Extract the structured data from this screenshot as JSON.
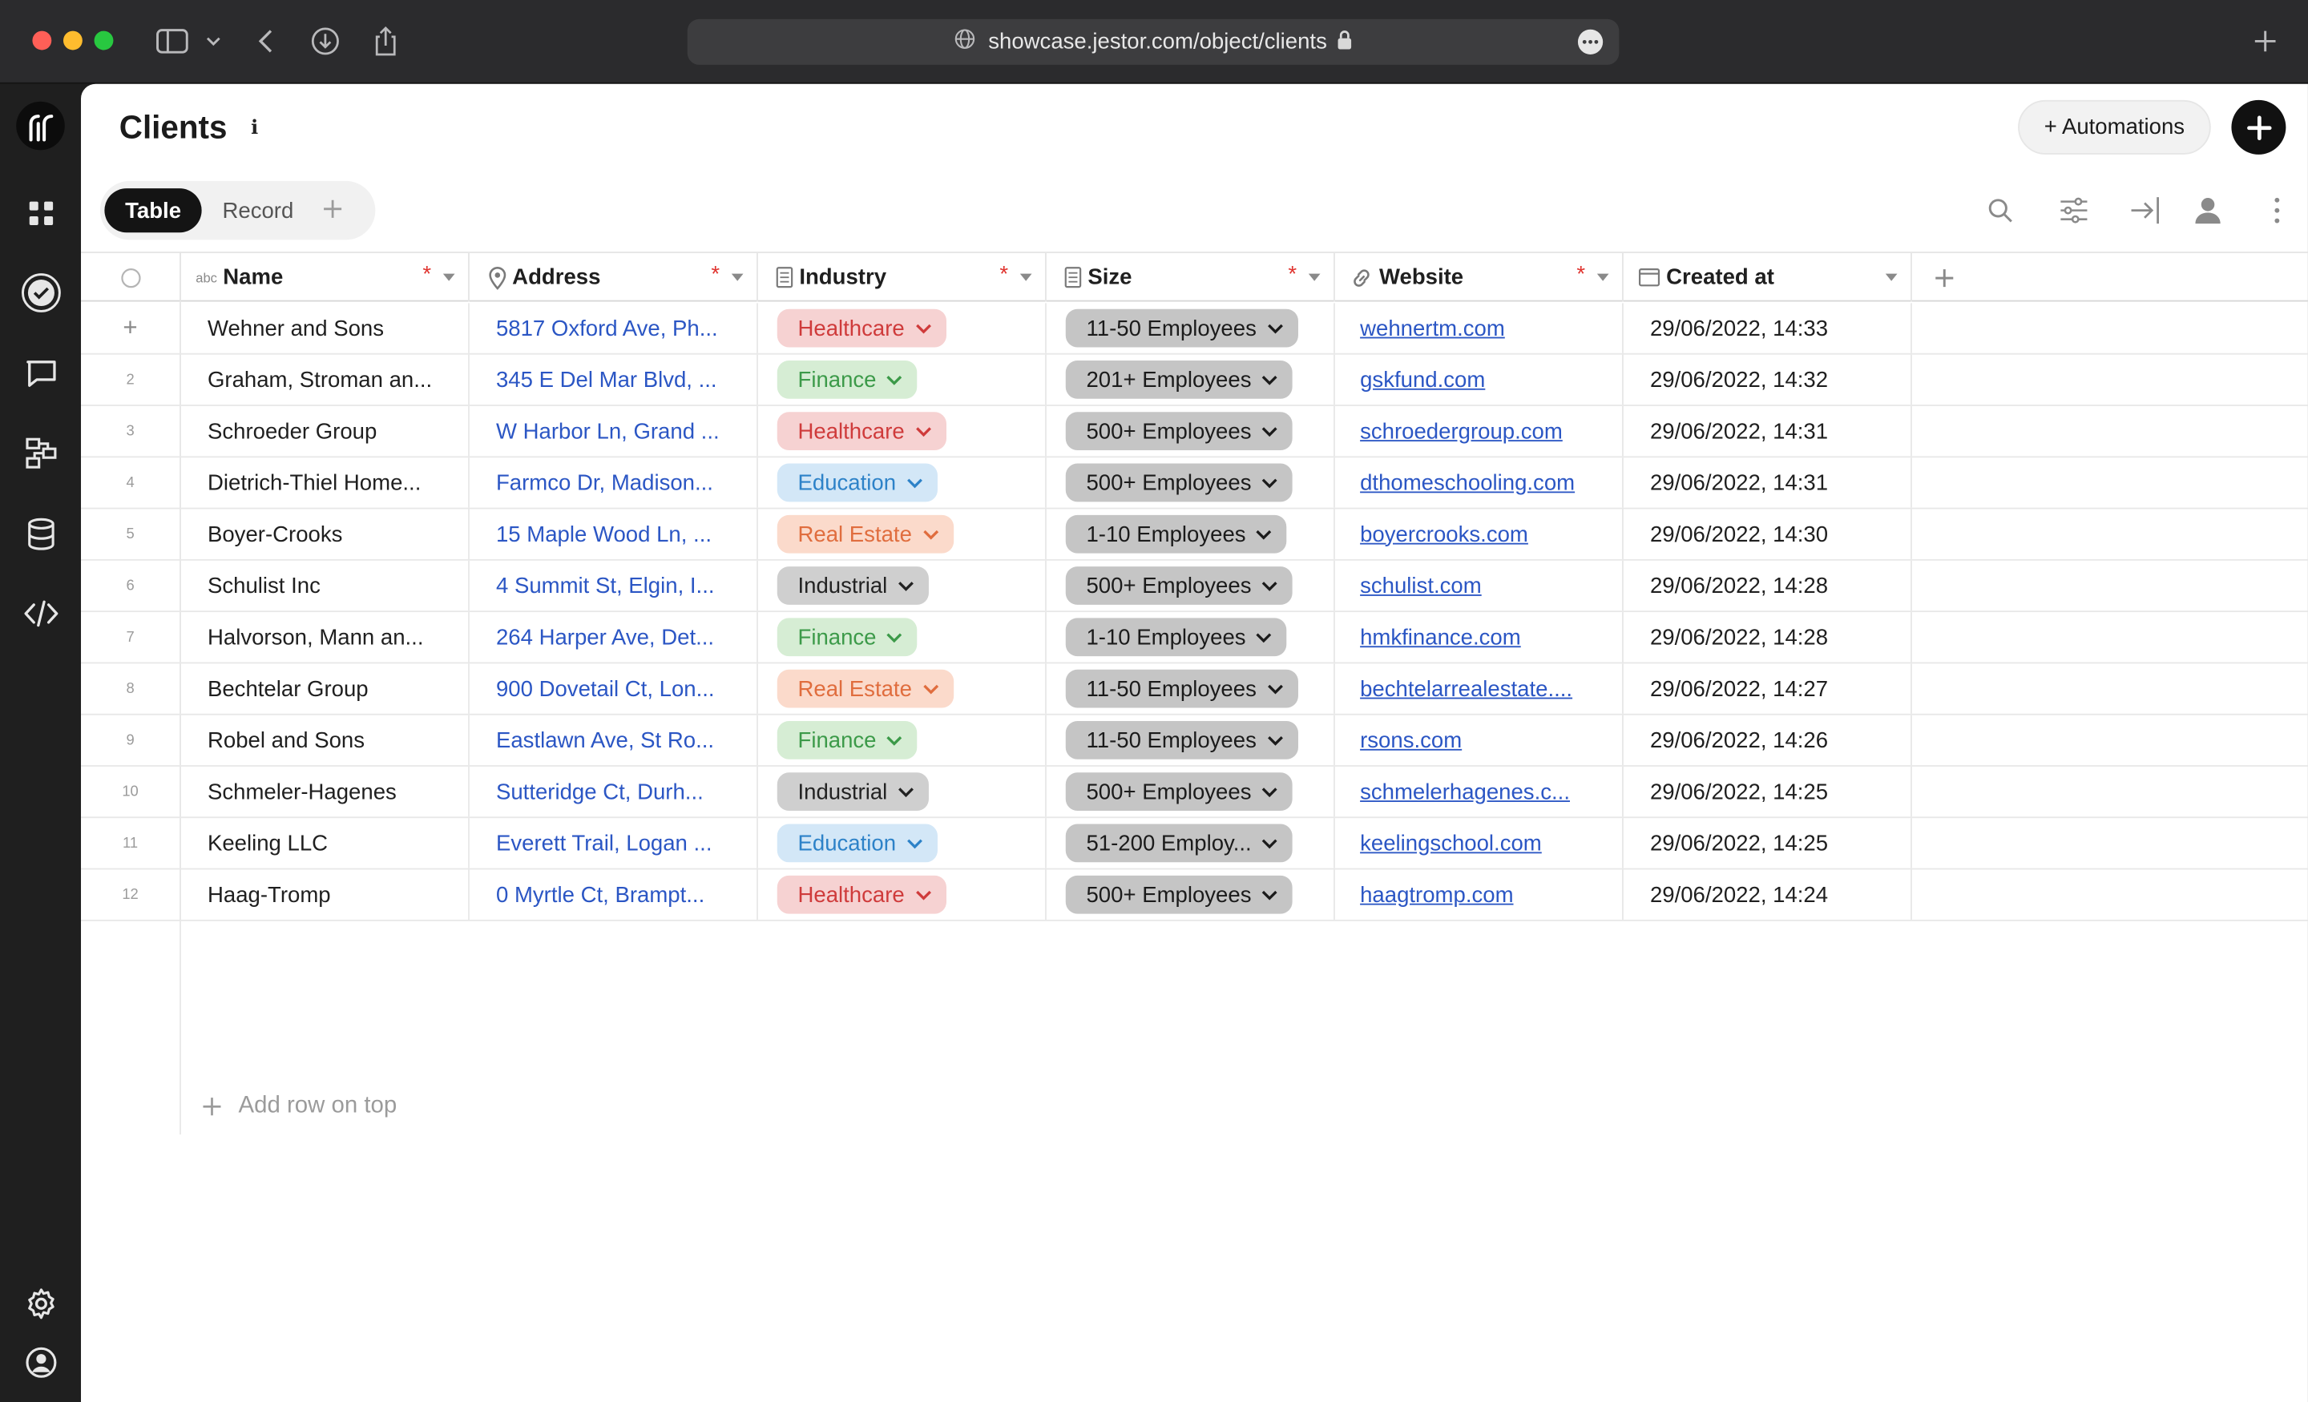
{
  "browser": {
    "url": "showcase.jestor.com/object/clients"
  },
  "page": {
    "title": "Clients",
    "automations_label": "+ Automations"
  },
  "tabs": [
    {
      "label": "Table",
      "active": true
    },
    {
      "label": "Record",
      "active": false
    }
  ],
  "table": {
    "columns": [
      {
        "key": "name",
        "label": "Name",
        "icon": "abc-text-icon",
        "required": true
      },
      {
        "key": "address",
        "label": "Address",
        "icon": "map-pin-icon",
        "required": true
      },
      {
        "key": "industry",
        "label": "Industry",
        "icon": "list-doc-icon",
        "required": true
      },
      {
        "key": "size",
        "label": "Size",
        "icon": "list-doc-icon",
        "required": true
      },
      {
        "key": "website",
        "label": "Website",
        "icon": "link-icon",
        "required": true
      },
      {
        "key": "created_at",
        "label": "Created at",
        "icon": "calendar-icon",
        "required": false
      }
    ],
    "required_mark": "*",
    "rows": [
      {
        "num": "+",
        "name": "Wehner and Sons",
        "address": "5817 Oxford Ave, Ph...",
        "industry": "Healthcare",
        "size": "11-50 Employees",
        "website": "wehnertm.com",
        "created_at": "29/06/2022, 14:33"
      },
      {
        "num": "2",
        "name": "Graham, Stroman an...",
        "address": "345 E Del Mar Blvd, ...",
        "industry": "Finance",
        "size": "201+ Employees",
        "website": "gskfund.com",
        "created_at": "29/06/2022, 14:32"
      },
      {
        "num": "3",
        "name": "Schroeder Group",
        "address": "W Harbor Ln, Grand ...",
        "industry": "Healthcare",
        "size": "500+ Employees",
        "website": "schroedergroup.com",
        "created_at": "29/06/2022, 14:31"
      },
      {
        "num": "4",
        "name": "Dietrich-Thiel Home...",
        "address": "Farmco Dr, Madison...",
        "industry": "Education",
        "size": "500+ Employees",
        "website": "dthomeschooling.com",
        "created_at": "29/06/2022, 14:31"
      },
      {
        "num": "5",
        "name": "Boyer-Crooks",
        "address": "15 Maple Wood Ln, ...",
        "industry": "Real Estate",
        "size": "1-10 Employees",
        "website": "boyercrooks.com",
        "created_at": "29/06/2022, 14:30"
      },
      {
        "num": "6",
        "name": "Schulist Inc",
        "address": "4 Summit St, Elgin, I...",
        "industry": "Industrial",
        "size": "500+ Employees",
        "website": "schulist.com",
        "created_at": "29/06/2022, 14:28"
      },
      {
        "num": "7",
        "name": "Halvorson, Mann an...",
        "address": "264 Harper Ave, Det...",
        "industry": "Finance",
        "size": "1-10 Employees",
        "website": "hmkfinance.com",
        "created_at": "29/06/2022, 14:28"
      },
      {
        "num": "8",
        "name": "Bechtelar Group",
        "address": "900 Dovetail Ct, Lon...",
        "industry": "Real Estate",
        "size": "11-50 Employees",
        "website": "bechtelarrealestate....",
        "created_at": "29/06/2022, 14:27"
      },
      {
        "num": "9",
        "name": "Robel and Sons",
        "address": "Eastlawn Ave, St Ro...",
        "industry": "Finance",
        "size": "11-50 Employees",
        "website": "rsons.com",
        "created_at": "29/06/2022, 14:26"
      },
      {
        "num": "10",
        "name": "Schmeler-Hagenes",
        "address": "Sutteridge Ct, Durh...",
        "industry": "Industrial",
        "size": "500+ Employees",
        "website": "schmelerhagenes.c...",
        "created_at": "29/06/2022, 14:25"
      },
      {
        "num": "11",
        "name": "Keeling LLC",
        "address": "Everett Trail, Logan ...",
        "industry": "Education",
        "size": "51-200 Employ...",
        "website": "keelingschool.com",
        "created_at": "29/06/2022, 14:25"
      },
      {
        "num": "12",
        "name": "Haag-Tromp",
        "address": "0 Myrtle Ct, Brampt...",
        "industry": "Healthcare",
        "size": "500+ Employees",
        "website": "haagtromp.com",
        "created_at": "29/06/2022, 14:24"
      }
    ],
    "add_row_label": "Add row on top"
  },
  "colors": {
    "healthcare": "#cf3b3b",
    "finance": "#3c9a49",
    "education": "#2d82c8",
    "real_estate": "#e06d3e",
    "industrial": "#222222",
    "link": "#2b56c4",
    "required": "#e0342f"
  }
}
